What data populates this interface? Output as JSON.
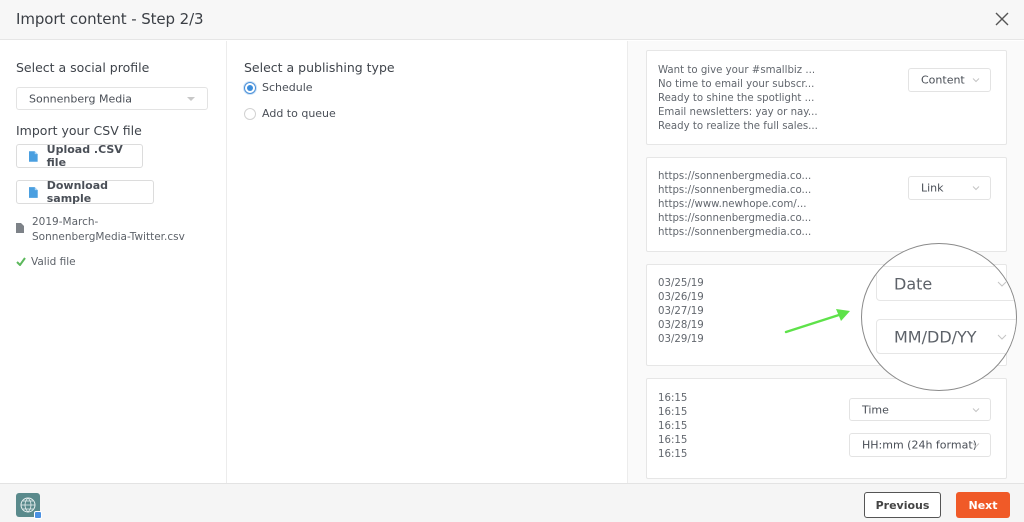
{
  "header": {
    "title": "Import content - Step 2/3",
    "close_icon": "close-icon"
  },
  "left": {
    "profile_label": "Select a social profile",
    "profile_select": {
      "value": "Sonnenberg Media"
    },
    "csv_label": "Import your CSV file",
    "upload_button": "Upload .CSV file",
    "download_button": "Download sample",
    "file_name_line1": "2019-March-",
    "file_name_line2": "SonnenbergMedia-Twitter.csv",
    "valid_status": "Valid file",
    "colors": {
      "file_icon": "#4a9fe0",
      "check": "#5cb85c"
    }
  },
  "middle": {
    "publishing_label": "Select a publishing type",
    "options": [
      {
        "label": "Schedule",
        "selected": true
      },
      {
        "label": "Add to queue",
        "selected": false
      }
    ]
  },
  "right": {
    "cards": [
      {
        "lines": [
          "Want to give your #smallbiz ...",
          "No time to email your subscr...",
          "Ready to shine the spotlight ...",
          "Email newsletters: yay or nay...",
          "Ready to realize the full sales..."
        ],
        "selects": [
          "Content"
        ]
      },
      {
        "lines": [
          "https://sonnenbergmedia.co...",
          "https://sonnenbergmedia.co...",
          "https://www.newhope.com/...",
          "https://sonnenbergmedia.co...",
          "https://sonnenbergmedia.co..."
        ],
        "selects": [
          "Link"
        ]
      },
      {
        "lines": [
          "03/25/19",
          "03/26/19",
          "03/27/19",
          "03/28/19",
          "03/29/19"
        ],
        "selects": [
          "Date",
          "MM/DD/YY"
        ]
      },
      {
        "lines": [
          "16:15",
          "16:15",
          "16:15",
          "16:15",
          "16:15"
        ],
        "selects": [
          "Time",
          "HH:mm (24h format)"
        ]
      }
    ],
    "annotation_color": "#5ee24a"
  },
  "footer": {
    "previous_button": "Previous",
    "next_button": "Next",
    "accent": "#f05a28"
  }
}
